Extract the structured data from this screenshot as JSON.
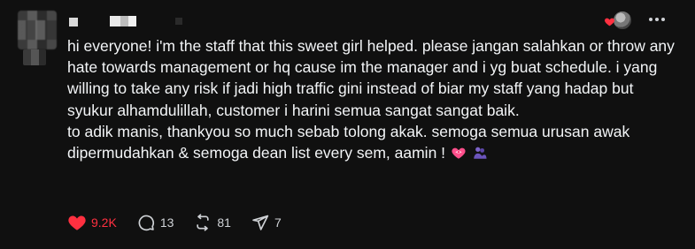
{
  "post": {
    "paragraphs": [
      "hi everyone! i'm the staff that this sweet girl helped. please jangan salahkan or throw any hate towards management or hq cause im the manager and i yg buat schedule. i yang willing to take any risk if jadi high traffic gini instead of biar my staff yang hadap but syukur alhamdulillah, customer i harini semua sangat sangat baik.",
      "to adik manis, thankyou so much sebab tolong akak. semoga semua urusan awak dipermudahkan & semoga dean list every sem, aamin !"
    ],
    "emojis": [
      "heart-with-ribbon-icon",
      "people-hugging-icon"
    ]
  },
  "actions": {
    "like_count": "9.2K",
    "reply_count": "13",
    "repost_count": "81",
    "share_count": "7"
  },
  "colors": {
    "background": "#101010",
    "text": "#f3f5f7",
    "like": "#ff3040",
    "muted": "#cfd2d6"
  }
}
